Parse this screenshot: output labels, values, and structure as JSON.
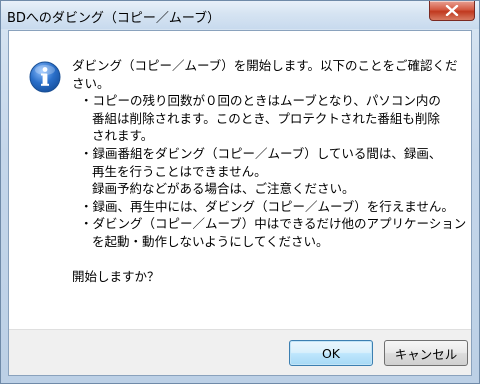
{
  "window": {
    "title": "BDへのダビング（コピー／ムーブ）"
  },
  "dialog": {
    "icon": "information-icon",
    "lines": [
      {
        "text": "ダビング（コピー／ムーブ）を開始します。以下のことをご確認くだ",
        "indent": 0
      },
      {
        "text": "さい。",
        "indent": 0
      },
      {
        "text": "・コピーの残り回数が０回のときはムーブとなり、パソコン内の",
        "indent": 1
      },
      {
        "text": "番組は削除されます。このとき、プロテクトされた番組も削除",
        "indent": 2
      },
      {
        "text": "されます。",
        "indent": 2
      },
      {
        "text": "・録画番組をダビング（コピー／ムーブ）している間は、録画、",
        "indent": 1
      },
      {
        "text": "再生を行うことはできません。",
        "indent": 2
      },
      {
        "text": "録画予約などがある場合は、ご注意ください。",
        "indent": 2
      },
      {
        "text": "・録画、再生中には、ダビング（コピー／ムーブ）を行えません。",
        "indent": 1
      },
      {
        "text": "・ダビング（コピー／ムーブ）中はできるだけ他のアプリケーション",
        "indent": 1
      },
      {
        "text": "を起動・動作しないようにしてください。",
        "indent": 2
      },
      {
        "text": "",
        "indent": 0
      },
      {
        "text": "開始しますか？",
        "indent": 0
      }
    ]
  },
  "buttons": {
    "ok_label": "OK",
    "cancel_label": "キャンセル"
  },
  "colors": {
    "close_button": "#c8452f",
    "info_icon": "#2a6fc9",
    "ok_border": "#3c7fb1"
  }
}
